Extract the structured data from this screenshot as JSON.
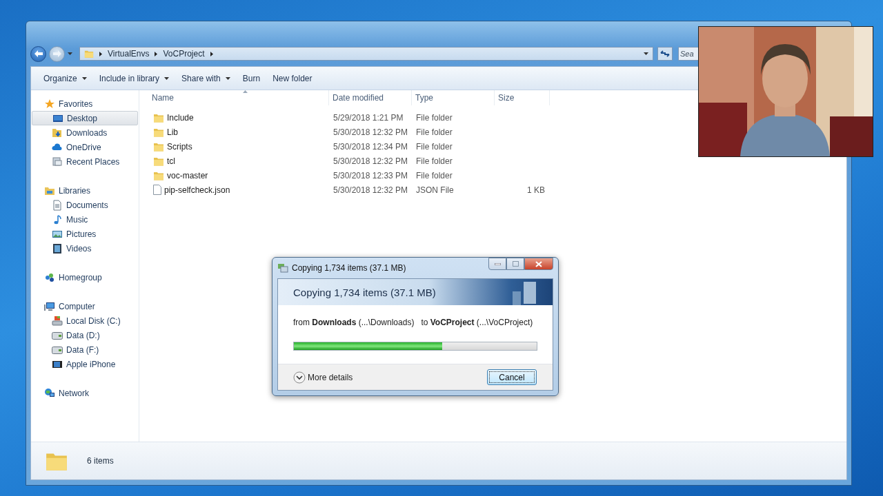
{
  "explorer": {
    "breadcrumb": [
      "VirtualEnvs",
      "VoCProject"
    ],
    "search": {
      "placeholder": "Sea"
    },
    "toolbar": [
      {
        "label": "Organize",
        "kind": "menu"
      },
      {
        "label": "Include in library",
        "kind": "menu"
      },
      {
        "label": "Share with",
        "kind": "menu"
      },
      {
        "label": "Burn",
        "kind": "plain"
      },
      {
        "label": "New folder",
        "kind": "plain"
      }
    ],
    "sidebar": [
      {
        "label": "Favorites",
        "kind": "star",
        "selected": false,
        "children": [
          {
            "label": "Desktop",
            "kind": "desktop",
            "selected": true
          },
          {
            "label": "Downloads",
            "kind": "downloads",
            "selected": false
          },
          {
            "label": "OneDrive",
            "kind": "cloud",
            "selected": false
          },
          {
            "label": "Recent Places",
            "kind": "recent",
            "selected": false
          }
        ]
      },
      {
        "label": "Libraries",
        "kind": "library",
        "selected": false,
        "children": [
          {
            "label": "Documents",
            "kind": "document",
            "selected": false
          },
          {
            "label": "Music",
            "kind": "music",
            "selected": false
          },
          {
            "label": "Pictures",
            "kind": "pictures",
            "selected": false
          },
          {
            "label": "Videos",
            "kind": "videos",
            "selected": false
          }
        ]
      },
      {
        "label": "Homegroup",
        "kind": "homegroup",
        "selected": false
      },
      {
        "label": "Computer",
        "kind": "computer",
        "selected": false,
        "children": [
          {
            "label": "Local Disk (C:)",
            "kind": "disk",
            "selected": false
          },
          {
            "label": "Data (D:)",
            "kind": "drive",
            "selected": false
          },
          {
            "label": "Data (F:)",
            "kind": "drive",
            "selected": false
          },
          {
            "label": "Apple iPhone",
            "kind": "phone",
            "selected": false
          }
        ]
      },
      {
        "label": "Network",
        "kind": "network",
        "selected": false
      }
    ],
    "columns": [
      "Name",
      "Date modified",
      "Type",
      "Size"
    ],
    "files": [
      {
        "name": "Include",
        "kind": "folder",
        "date": "5/29/2018 1:21 PM",
        "type": "File folder"
      },
      {
        "name": "Lib",
        "kind": "folder",
        "date": "5/30/2018 12:32 PM",
        "type": "File folder"
      },
      {
        "name": "Scripts",
        "kind": "folder",
        "date": "5/30/2018 12:34 PM",
        "type": "File folder"
      },
      {
        "name": "tcl",
        "kind": "folder",
        "date": "5/30/2018 12:32 PM",
        "type": "File folder"
      },
      {
        "name": "voc-master",
        "kind": "folder",
        "date": "5/30/2018 12:33 PM",
        "type": "File folder"
      },
      {
        "name": "pip-selfcheck.json",
        "kind": "file",
        "date": "5/30/2018 12:32 PM",
        "type": "JSON File",
        "size": "1 KB"
      }
    ],
    "status_bar": "6 items"
  },
  "dialog": {
    "title": "Copying 1,734 items (37.1 MB)",
    "heading": "Copying 1,734 items (37.1 MB)",
    "route": "from **Downloads** (...\\Downloads)   to **VoCProject** (...\\VoCProject)",
    "progress": {
      "level": 0.61
    },
    "details": "More details",
    "cancel": "Cancel"
  }
}
